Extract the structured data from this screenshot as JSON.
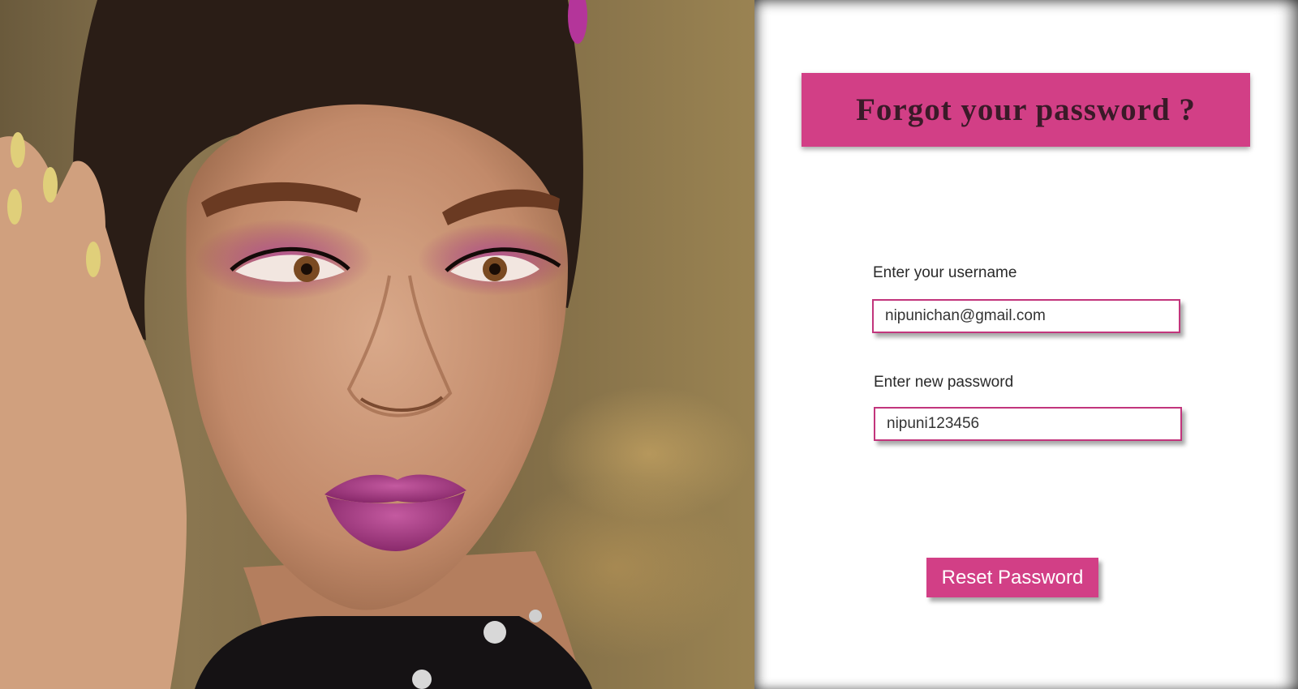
{
  "form": {
    "title": "Forgot your password ?",
    "username": {
      "label": "Enter your username",
      "value": "nipunichan@gmail.com"
    },
    "password": {
      "label": "Enter new password",
      "value": "nipuni123456"
    },
    "submit_label": "Reset Password"
  },
  "colors": {
    "accent": "#d23f86",
    "input_border": "#c2357c",
    "title_text": "#3a1a28"
  },
  "photo": {
    "subject": "portrait-photo"
  }
}
